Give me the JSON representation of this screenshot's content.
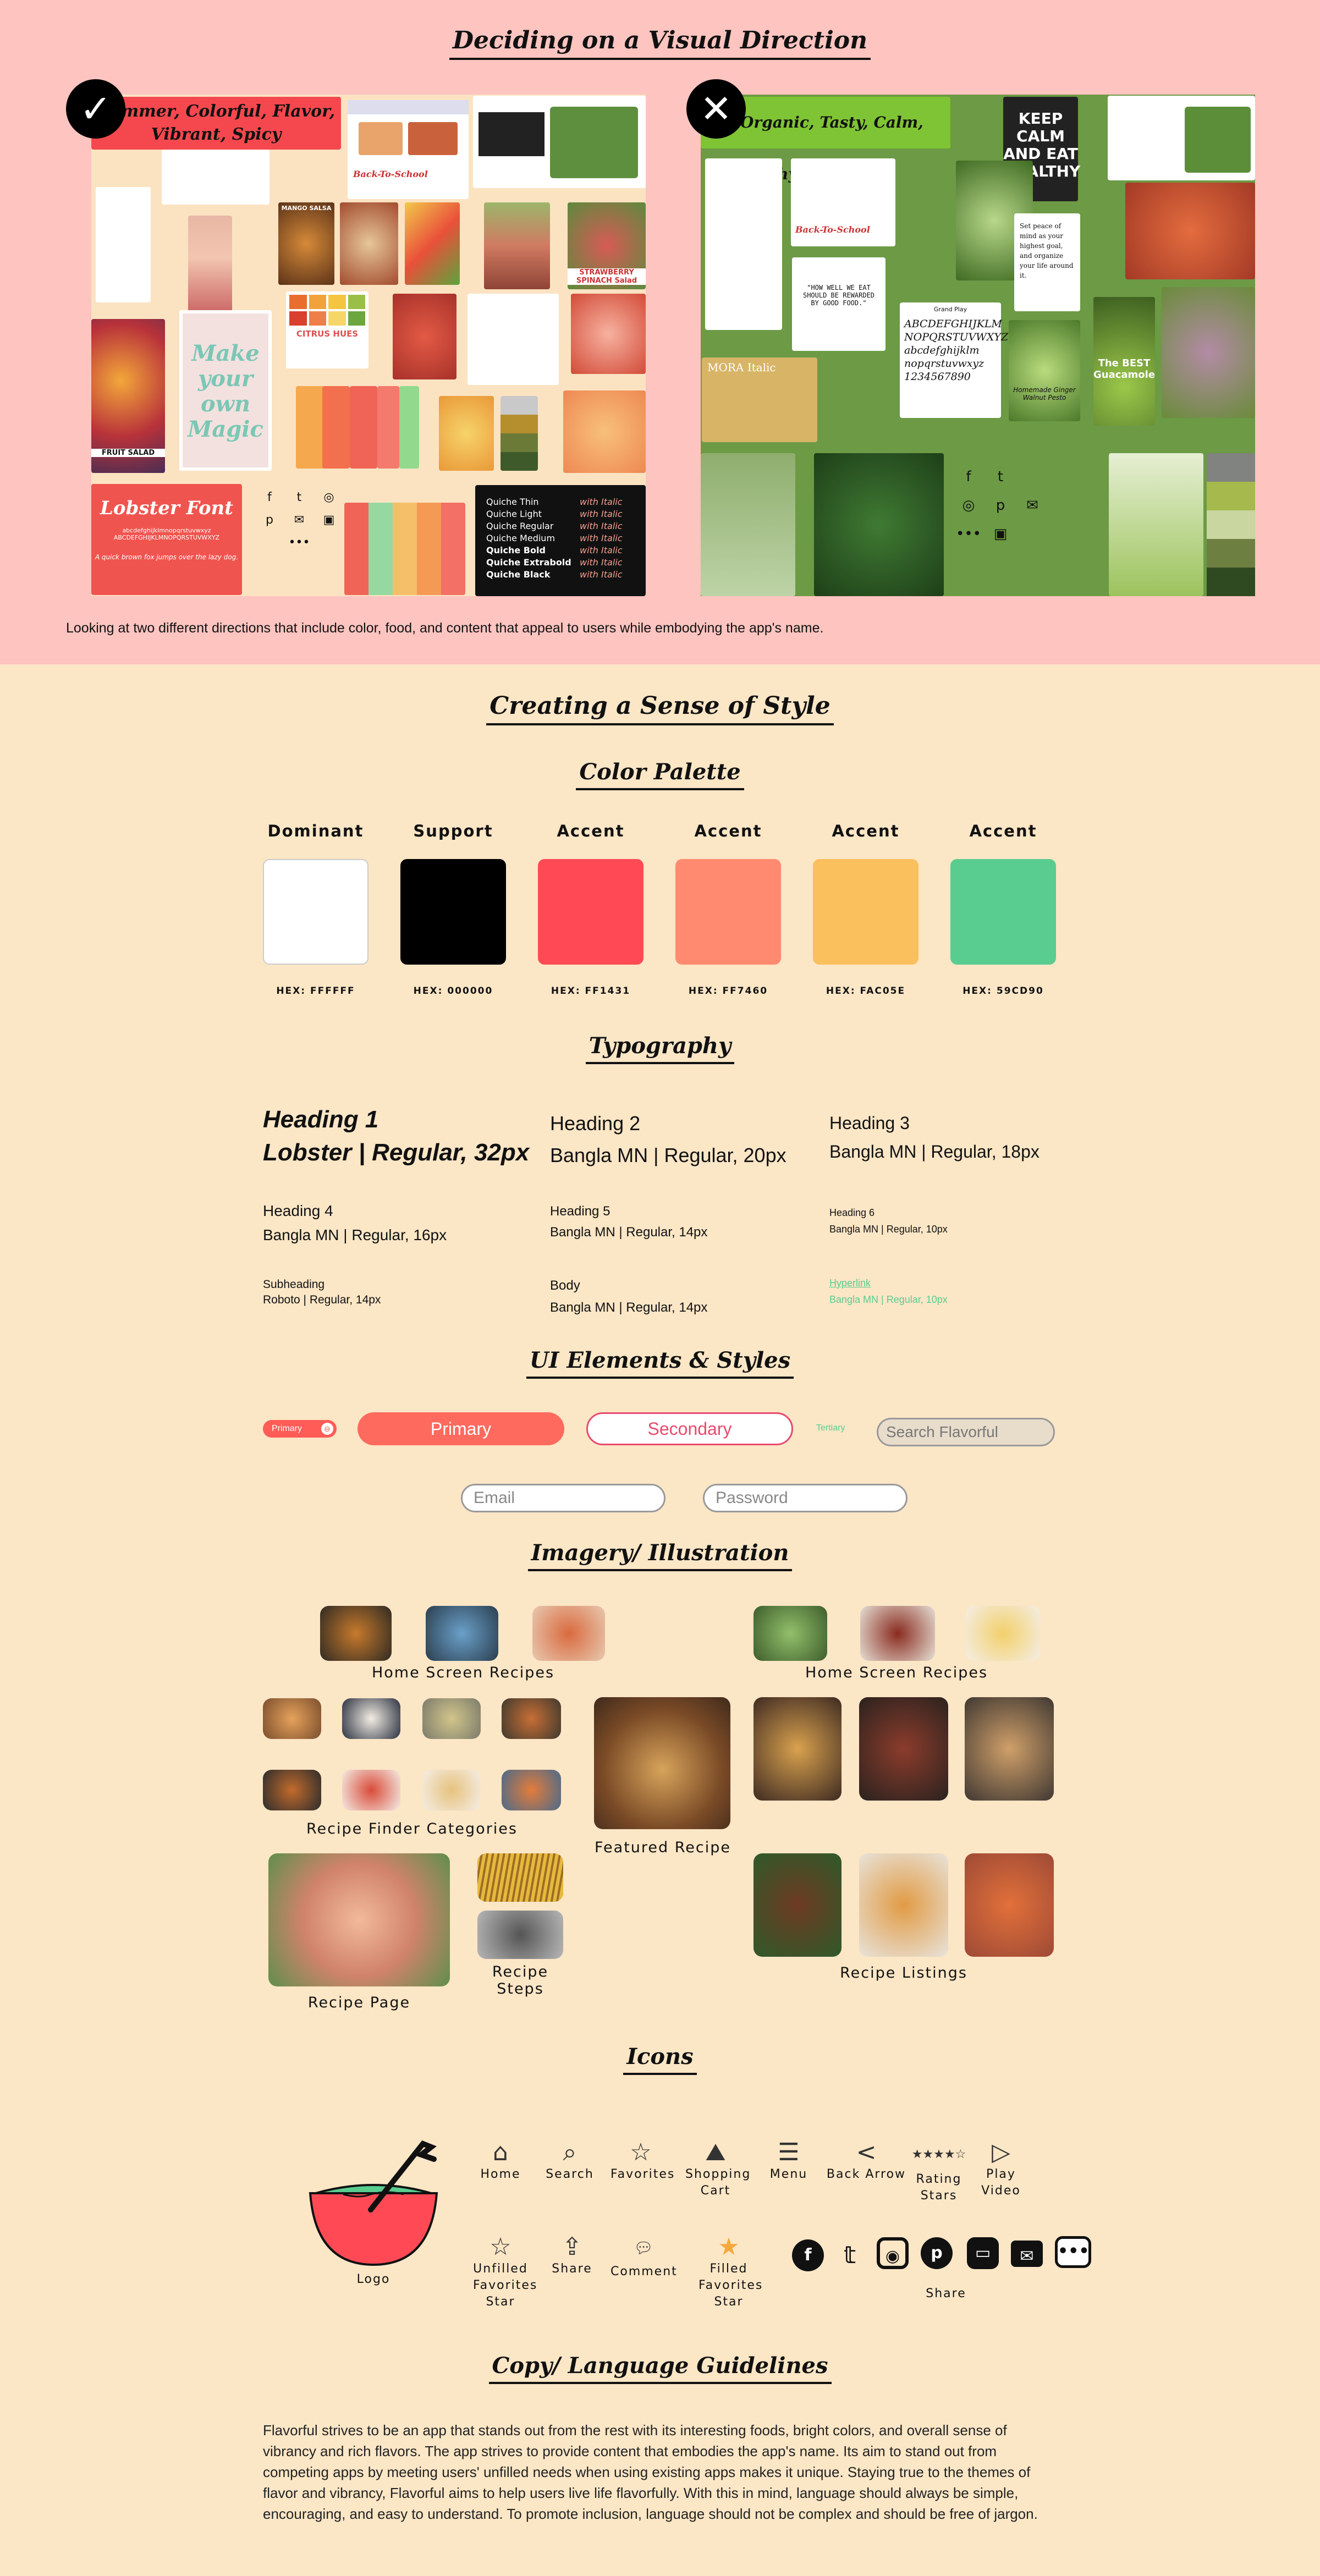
{
  "sections": {
    "direction": "Deciding on a Visual Direction",
    "style": "Creating a Sense of Style",
    "palette": "Color Palette",
    "typography": "Typography",
    "ui": "UI Elements & Styles",
    "imagery": "Imagery/ Illustration",
    "icons": "Icons",
    "copy": "Copy/ Language Guidelines"
  },
  "direction": {
    "board1_title": "Summer, Colorful, Flavor, Vibrant, Spicy",
    "board2_title": "Organic, Tasty, Calm, Earthy",
    "caption": "Looking at two different directions that include color, food, and content that appeal to users while embodying the app's name.",
    "board1": {
      "font_tile": "Lobster Font",
      "font_tile_alpha": "abcdefghijklmnopqrstuvwxyz ABCDEFGHIJKLMNOPQRSTUVWXYZ",
      "font_tile_tag": "A quick brown fox jumps over the lazy dog.",
      "citrus": "CITRUS HUES",
      "make_magic": "Make your own Magic",
      "fruit_salad": "FRUIT SALAD",
      "mango": "MANGO SALSA",
      "strawberry": "STRAWBERRY SPINACH Salad",
      "back_to_school": "Back-To-School",
      "quicke": [
        "Quiche Thin",
        "Quiche Light",
        "Quiche Regular",
        "Quiche Medium",
        "Quiche Bold",
        "Quiche Extrabold",
        "Quiche Black"
      ],
      "italic": "with Italic"
    },
    "board2": {
      "keep_calm": "KEEP CALM AND EAT HEALTHY",
      "quote": "\"HOW WELL WE EAT SHOULD BE REWARDED BY GOOD FOOD.\"",
      "font_name": "Grand Play",
      "alphabet": "ABCDEFGHIJKLM NOPQRSTUVWXYZ abcdefghijklm nopqrstuvwxyz 1234567890",
      "mora": "MORA Italic",
      "best_guac": "The BEST Guacamole",
      "smoothie": "Homemade Ginger Walnut Pesto",
      "peace": "Set peace of mind as your highest goal, and organize your life around it.",
      "swatches": [
        "#80837F",
        "#A6B94D",
        "#C9D6A0",
        "#6E7F42",
        "#2F4A21"
      ]
    }
  },
  "palette": [
    {
      "label": "Dominant",
      "hex": "#FFFFFF",
      "code": "HEX: FFFFFF"
    },
    {
      "label": "Support",
      "hex": "#000000",
      "code": "HEX: 000000"
    },
    {
      "label": "Accent",
      "hex": "#FF4A55",
      "code": "HEX: FF1431"
    },
    {
      "label": "Accent",
      "hex": "#FF8A70",
      "code": "HEX: FF7460"
    },
    {
      "label": "Accent",
      "hex": "#FAC05E",
      "code": "HEX: FAC05E"
    },
    {
      "label": "Accent",
      "hex": "#59CD90",
      "code": "HEX: 59CD90"
    }
  ],
  "typography": {
    "h1": "Heading 1",
    "h1_spec": "Lobster | Regular, 32px",
    "h2": "Heading 2",
    "h2_spec": "Bangla MN | Regular, 20px",
    "h3": "Heading 3",
    "h3_spec": "Bangla MN | Regular, 18px",
    "h4": "Heading 4",
    "h4_spec": "Bangla MN | Regular, 16px",
    "h5": "Heading 5",
    "h5_spec": "Bangla MN | Regular, 14px",
    "h6": "Heading 6",
    "h6_spec": "Bangla MN | Regular, 10px",
    "subheading": "Subheading",
    "subheading_spec": "Roboto | Regular, 14px",
    "body": "Body",
    "body_spec": "Bangla MN | Regular, 14px",
    "hyperlink": "Hyperlink",
    "hyperlink_spec": "Bangla MN | Regular, 10px"
  },
  "ui": {
    "chip_primary": "Primary",
    "primary": "Primary",
    "secondary": "Secondary",
    "tertiary": "Tertiary",
    "search_placeholder": "Search Flavorful",
    "email_placeholder": "Email",
    "password_placeholder": "Password"
  },
  "imagery": {
    "home_left": "Home Screen Recipes",
    "home_right": "Home Screen Recipes",
    "finder": "Recipe Finder Categories",
    "featured": "Featured Recipe",
    "page": "Recipe Page",
    "steps": "Recipe Steps",
    "listings": "Recipe Listings"
  },
  "icons": {
    "logo": "Logo",
    "home": "Home",
    "search": "Search",
    "favorites": "Favorites",
    "cart": "Shopping Cart",
    "menu": "Menu",
    "back": "Back Arrow",
    "rating": "Rating Stars",
    "play": "Play Video",
    "unfilled": "Unfilled Favorites Star",
    "share": "Share",
    "comment": "Comment",
    "filled": "Filled Favorites Star",
    "share2": "Share"
  },
  "copy": {
    "body": "Flavorful strives to be an app that stands out from the rest with its interesting foods, bright colors, and overall sense of vibrancy and rich flavors. The app strives to provide content that embodies the app's name. Its aim to stand out from competing apps by meeting users' unfilled needs when using existing apps makes it unique. Staying true to the themes of flavor and vibrancy, Flavorful aims to help users live life flavorfully. With this in mind, language should always be simple, encouraging, and easy to understand. To promote inclusion, language should not be complex and should be free of jargon."
  }
}
